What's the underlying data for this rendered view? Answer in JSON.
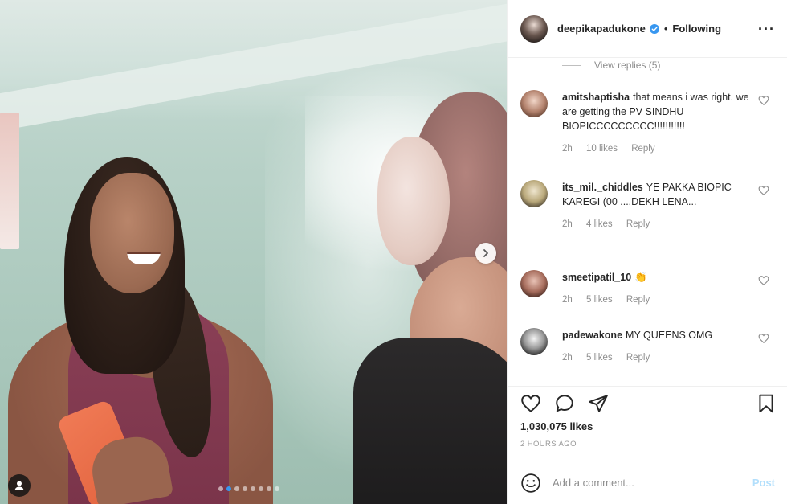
{
  "post": {
    "username": "deepikapadukone",
    "follow_status": "Following",
    "separator": "•",
    "more_icon": "···",
    "carousel": {
      "total_slides": 8,
      "active_index": 1
    }
  },
  "comments": {
    "view_replies": "View replies (5)",
    "items": [
      {
        "username": "amitshaptisha",
        "text": "that means i was right. we are getting the PV SINDHU BIOPICCCCCCCCC!!!!!!!!!!!",
        "time": "2h",
        "likes": "10 likes",
        "reply": "Reply"
      },
      {
        "username": "its_mil._chiddles",
        "text": "YE PAKKA BIOPIC KAREGI (00 ....DEKH LENA...",
        "time": "2h",
        "likes": "4 likes",
        "reply": "Reply"
      },
      {
        "username": "smeetipatil_10",
        "text": "👏",
        "time": "2h",
        "likes": "5 likes",
        "reply": "Reply"
      },
      {
        "username": "padewakone",
        "text": "MY QUEENS OMG",
        "time": "2h",
        "likes": "5 likes",
        "reply": "Reply"
      }
    ]
  },
  "actions": {
    "likes_count": "1,030,075 likes",
    "date": "2 HOURS AGO"
  },
  "add_comment": {
    "placeholder": "Add a comment...",
    "post_label": "Post"
  },
  "colors": {
    "accent": "#3897f0",
    "post_disabled": "#b2dffc",
    "muted_text": "#8e8e8e"
  },
  "icons": [
    "verified-badge-icon",
    "more-options-icon",
    "heart-icon",
    "comment-icon",
    "share-icon",
    "bookmark-icon",
    "emoji-icon",
    "chevron-right-icon",
    "user-tag-icon"
  ]
}
